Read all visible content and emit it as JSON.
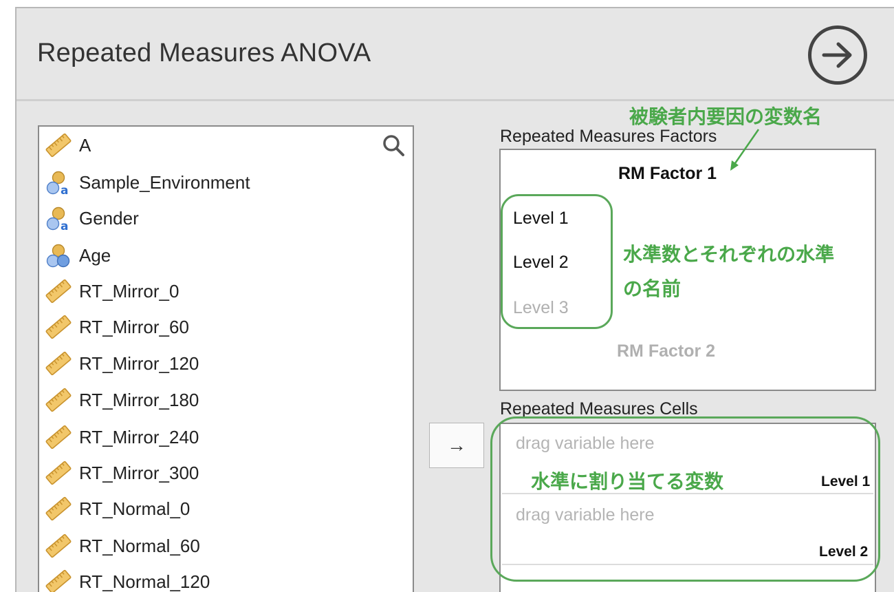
{
  "dialog": {
    "title": "Repeated Measures ANOVA"
  },
  "variables": [
    {
      "name": "A",
      "type": "ruler-icon"
    },
    {
      "name": "Sample_Environment",
      "type": "nominal-text-icon"
    },
    {
      "name": "Gender",
      "type": "nominal-text-icon"
    },
    {
      "name": "Age",
      "type": "nominal-icon"
    },
    {
      "name": "RT_Mirror_0",
      "type": "ruler-icon"
    },
    {
      "name": "RT_Mirror_60",
      "type": "ruler-icon"
    },
    {
      "name": "RT_Mirror_120",
      "type": "ruler-icon"
    },
    {
      "name": "RT_Mirror_180",
      "type": "ruler-icon"
    },
    {
      "name": "RT_Mirror_240",
      "type": "ruler-icon"
    },
    {
      "name": "RT_Mirror_300",
      "type": "ruler-icon"
    },
    {
      "name": "RT_Normal_0",
      "type": "ruler-icon"
    },
    {
      "name": "RT_Normal_60",
      "type": "ruler-icon"
    },
    {
      "name": "RT_Normal_120",
      "type": "ruler-icon"
    }
  ],
  "move_button": {
    "glyph": "→"
  },
  "factors": {
    "label": "Repeated Measures Factors",
    "factor1": "RM Factor 1",
    "levels": [
      "Level 1",
      "Level 2",
      "Level 3"
    ],
    "factor2": "RM Factor 2"
  },
  "cells": {
    "label": "Repeated Measures Cells",
    "rows": [
      {
        "placeholder": "drag variable here",
        "level": "Level 1"
      },
      {
        "placeholder": "drag variable here",
        "level": "Level 2"
      }
    ]
  },
  "annotations": {
    "factor_name": "被験者内要因の変数名",
    "levels_line1": "水準数とそれぞれの水準",
    "levels_line2": "の名前",
    "cells": "水準に割り当てる変数"
  },
  "colors": {
    "annotation": "#4aa84a",
    "ruler": "#f2c76a",
    "nominal_top": "#e8b955",
    "nominal_bottom": "#6f9ee0",
    "nominal_text": "#2f6fd0",
    "inactive": "#b4b4b4"
  }
}
